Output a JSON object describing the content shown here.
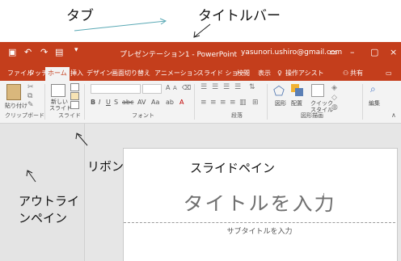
{
  "annotations": {
    "tab": "タブ",
    "titlebar": "タイトルバー",
    "ribbon": "リボン",
    "slide_pane": "スライドペイン",
    "outline_pane_line1": "アウトライ",
    "outline_pane_line2": "ンペイン"
  },
  "window": {
    "title": "プレゼンテーション1 - PowerPoint",
    "account": "yasunori.ushiro@gmail.com"
  },
  "tabs": [
    "ファイル",
    "タッチ",
    "ホーム",
    "挿入",
    "デザイン",
    "画面切り替え",
    "アニメーション",
    "スライド ショー",
    "校閲",
    "表示",
    "操作アシスト",
    "共有"
  ],
  "active_tab": "ホーム",
  "ribbon": {
    "paste_label": "貼り付け",
    "new_slide_label_1": "新しい",
    "new_slide_label_2": "スライド",
    "shape_label": "図形",
    "arrange_label": "配置",
    "quick_style_label_1": "クイック",
    "quick_style_label_2": "スタイル",
    "edit_label": "編集",
    "groups": {
      "clipboard": "クリップボード",
      "slides": "スライド",
      "font": "フォント",
      "paragraph": "段落",
      "drawing": "図形描画"
    }
  },
  "slide": {
    "title_placeholder": "タイトルを入力",
    "subtitle_placeholder": "サブタイトルを入力"
  },
  "colors": {
    "accent": "#c43e1c",
    "ribbon_bg": "#f3f3f3",
    "workspace_bg": "#e6e6e6"
  }
}
